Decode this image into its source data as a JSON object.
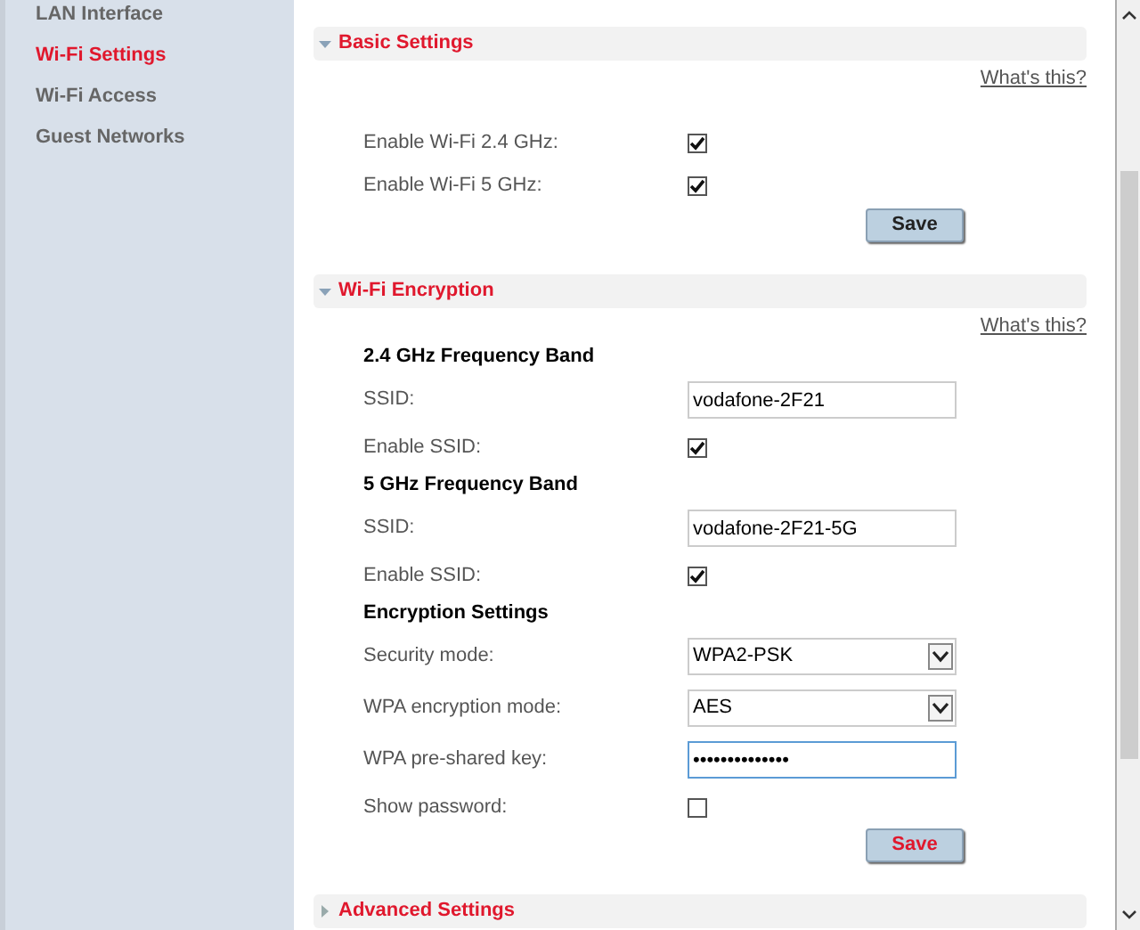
{
  "sidebar": {
    "items": [
      {
        "label": "LAN Interface",
        "selected": false
      },
      {
        "label": "Wi-Fi Settings",
        "selected": true
      },
      {
        "label": "Wi-Fi Access",
        "selected": false
      },
      {
        "label": "Guest Networks",
        "selected": false
      }
    ]
  },
  "sections": [
    {
      "title": "Basic Settings",
      "expanded": true,
      "help_link": "What's this?",
      "rows": [
        {
          "kind": "spacer"
        },
        {
          "kind": "checkbox",
          "label": "Enable Wi-Fi 2.4 GHz:",
          "checked": true
        },
        {
          "kind": "checkbox",
          "label": "Enable Wi-Fi 5 GHz:",
          "checked": true
        }
      ],
      "save": {
        "label": "Save",
        "highlighted": false
      }
    },
    {
      "title": "Wi-Fi Encryption",
      "expanded": true,
      "help_link": "What's this?",
      "rows": [
        {
          "kind": "heading",
          "label": "2.4 GHz Frequency Band"
        },
        {
          "kind": "text",
          "label": "SSID:",
          "value": "vodafone-2F21",
          "focused": false
        },
        {
          "kind": "checkbox",
          "label": "Enable SSID:",
          "checked": true
        },
        {
          "kind": "heading",
          "label": "5 GHz Frequency Band"
        },
        {
          "kind": "text",
          "label": "SSID:",
          "value": "vodafone-2F21-5G",
          "focused": false
        },
        {
          "kind": "checkbox",
          "label": "Enable SSID:",
          "checked": true
        },
        {
          "kind": "heading",
          "label": "Encryption Settings"
        },
        {
          "kind": "select",
          "label": "Security mode:",
          "value": "WPA2-PSK"
        },
        {
          "kind": "select",
          "label": "WPA encryption mode:",
          "value": "AES"
        },
        {
          "kind": "password",
          "label": "WPA pre-shared key:",
          "value": "••••••••••••••",
          "focused": true
        },
        {
          "kind": "checkbox",
          "label": "Show password:",
          "checked": false
        }
      ],
      "save": {
        "label": "Save",
        "highlighted": true
      }
    },
    {
      "title": "Advanced Settings",
      "expanded": false
    }
  ]
}
